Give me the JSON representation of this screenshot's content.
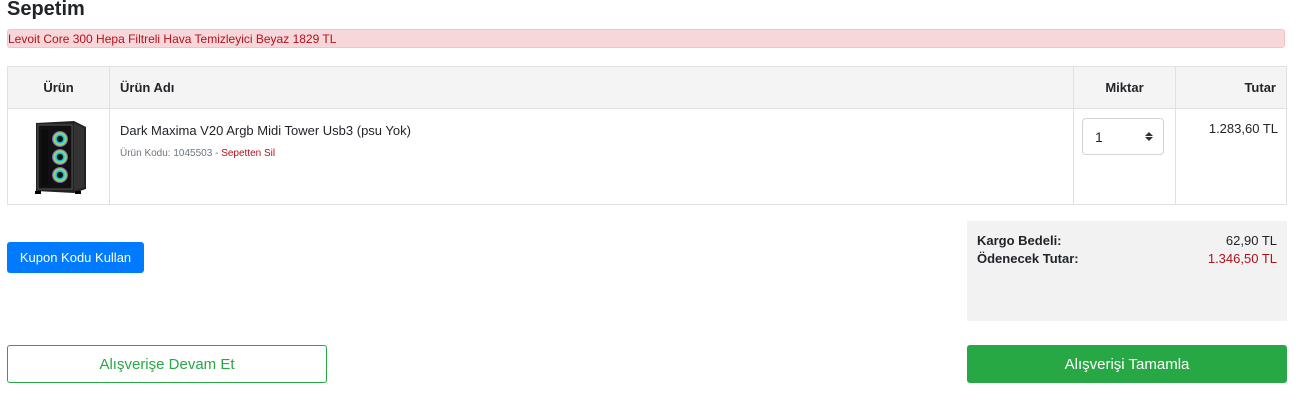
{
  "page": {
    "title": "Sepetim"
  },
  "alert": {
    "text": "Levoit Core 300 Hepa Filtreli Hava Temizleyici Beyaz 1829 TL"
  },
  "table": {
    "headers": {
      "image": "Ürün",
      "name": "Ürün Adı",
      "quantity": "Miktar",
      "total": "Tutar"
    },
    "items": [
      {
        "name": "Dark Maxima V20 Argb Midi Tower Usb3 (psu Yok)",
        "code_label": "Ürün Kodu: 1045503",
        "separator": " - ",
        "remove_label": "Sepetten Sil",
        "quantity": "1",
        "total": "1.283,60 TL",
        "image_icon": "pc-case-icon"
      }
    ]
  },
  "coupon": {
    "button_label": "Kupon Kodu Kullan"
  },
  "summary": {
    "shipping_label": "Kargo Bedeli:",
    "shipping_value": "62,90 TL",
    "payable_label": "Ödenecek Tutar:",
    "payable_value": "1.346,50 TL"
  },
  "actions": {
    "continue_label": "Alışverişe Devam Et",
    "checkout_label": "Alışverişi Tamamla"
  },
  "colors": {
    "primary": "#007bff",
    "success": "#28a745",
    "danger_text": "#b0121b",
    "alert_bg": "#f8d7da"
  }
}
